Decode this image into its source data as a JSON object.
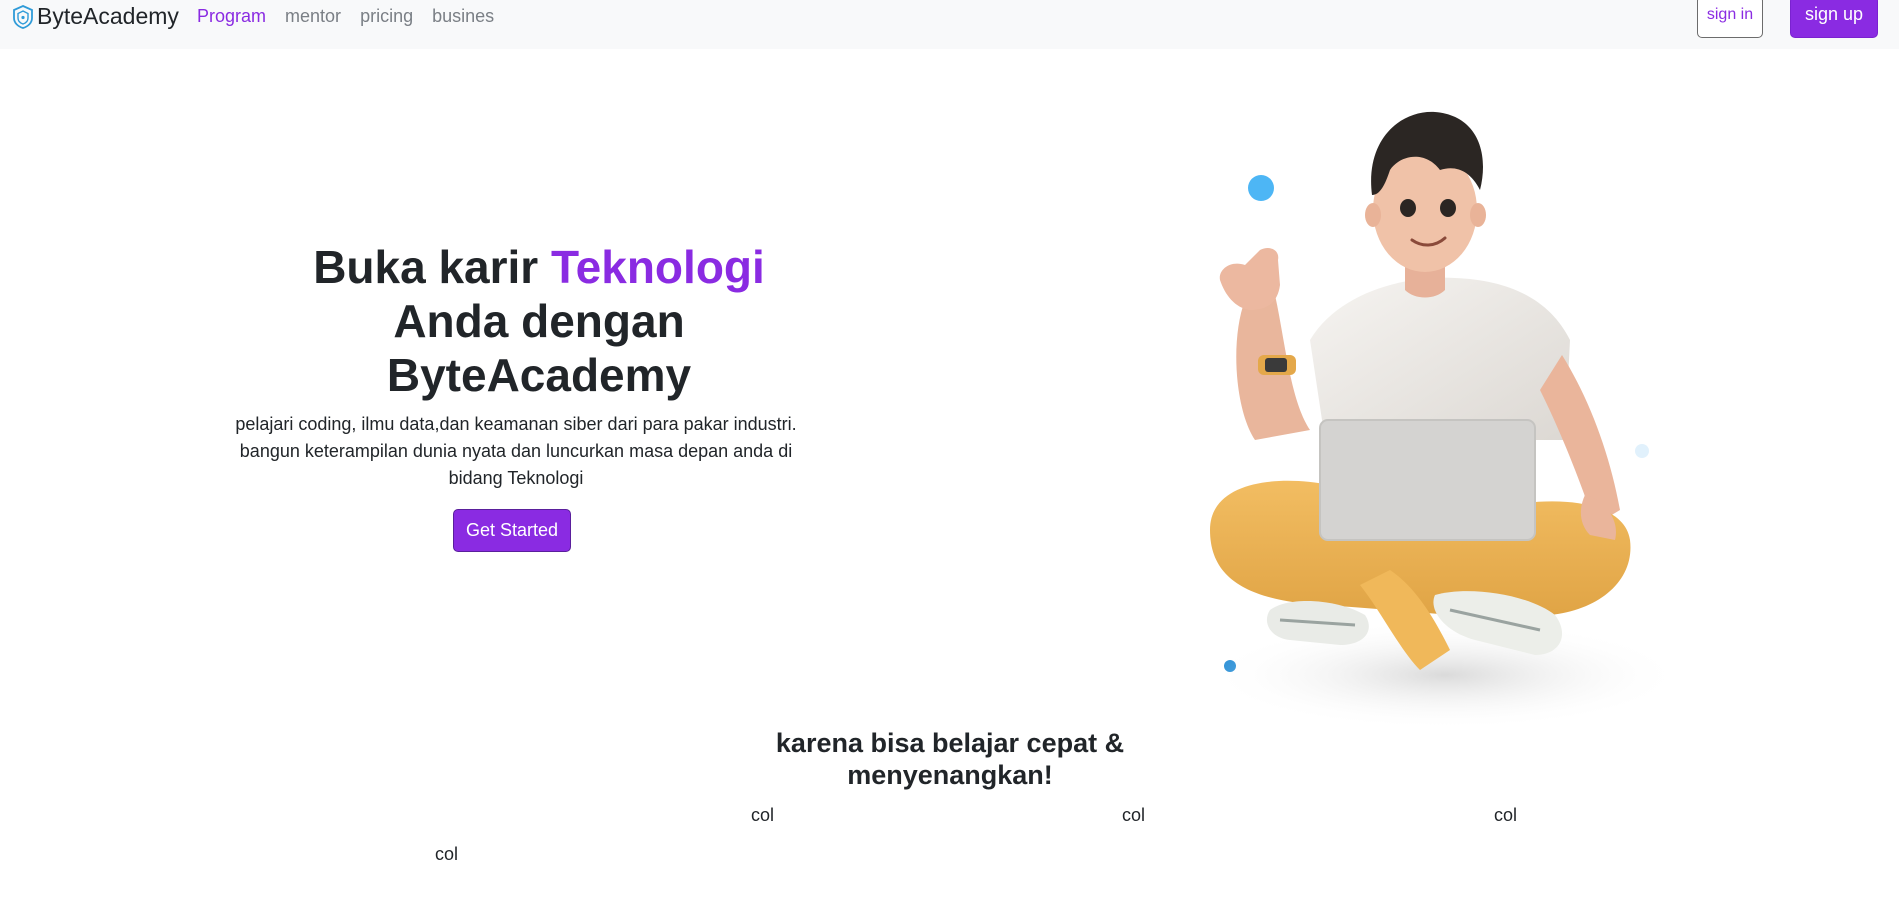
{
  "navbar": {
    "brand": "ByteAcademy",
    "links": [
      {
        "label": "Program",
        "active": true
      },
      {
        "label": "mentor",
        "active": false
      },
      {
        "label": "pricing",
        "active": false
      },
      {
        "label": "busines",
        "active": false
      }
    ],
    "signin_label": "sign in",
    "signup_label": "sign up"
  },
  "hero": {
    "title_part1": "Buka karir ",
    "title_accent": "Teknologi",
    "title_part2": " Anda dengan ByteAcademy",
    "description": "pelajari coding, ilmu data,dan keamanan siber dari para pakar industri. bangun keterampilan dunia nyata dan luncurkan masa depan anda di bidang Teknologi",
    "cta_label": "Get Started"
  },
  "features": {
    "title": "karena bisa belajar cepat & menyenangkan!",
    "cols": [
      "col",
      "col",
      "col",
      "col"
    ]
  },
  "colors": {
    "accent": "#8a2be2",
    "navbar_bg": "#f8f9fa",
    "text": "#212529",
    "muted": "#7a7f85"
  }
}
